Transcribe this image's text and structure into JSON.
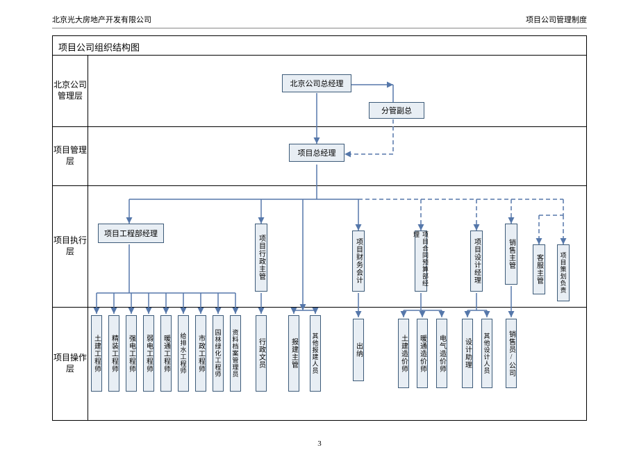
{
  "header": {
    "left": "北京光大房地产开发有限公司",
    "right": "项目公司管理制度"
  },
  "title": "项目公司组织结构图",
  "rows": {
    "r1": "北京公司管理层",
    "r2": "项目管理层",
    "r3": "项目执行层",
    "r4": "项目操作层"
  },
  "nodes": {
    "gm": "北京公司总经理",
    "vp": "分管副总",
    "pm": "项目总经理",
    "eng_mgr": "项目工程部经理",
    "admin": "项目行政主管",
    "fin": "项目财务会计",
    "budget": "项目合同预算部经理",
    "design": "项目设计经理",
    "sales_sup": "销售主管",
    "cs_sup": "客服主管",
    "plan_lead": "项目策划负责"
  },
  "leaves": {
    "e1": "土建工程师",
    "e2": "精装工程师",
    "e3": "强电工程师",
    "e4": "弱电工程师",
    "e5": "暖通工程师",
    "e6": "给排水工程师",
    "e7": "市政工程师",
    "e8": "园林绿化工程师",
    "e9": "资料档案管理员",
    "a1": "行政文员",
    "a2": "报建主管",
    "a3": "其他报建人员",
    "f1": "出纳",
    "b1": "土建造价师",
    "b2": "暖通造价师",
    "b3": "电气造价师",
    "d1": "设计助理",
    "d2": "其他设计人员",
    "s1": "销售员/公司"
  },
  "page": "3"
}
